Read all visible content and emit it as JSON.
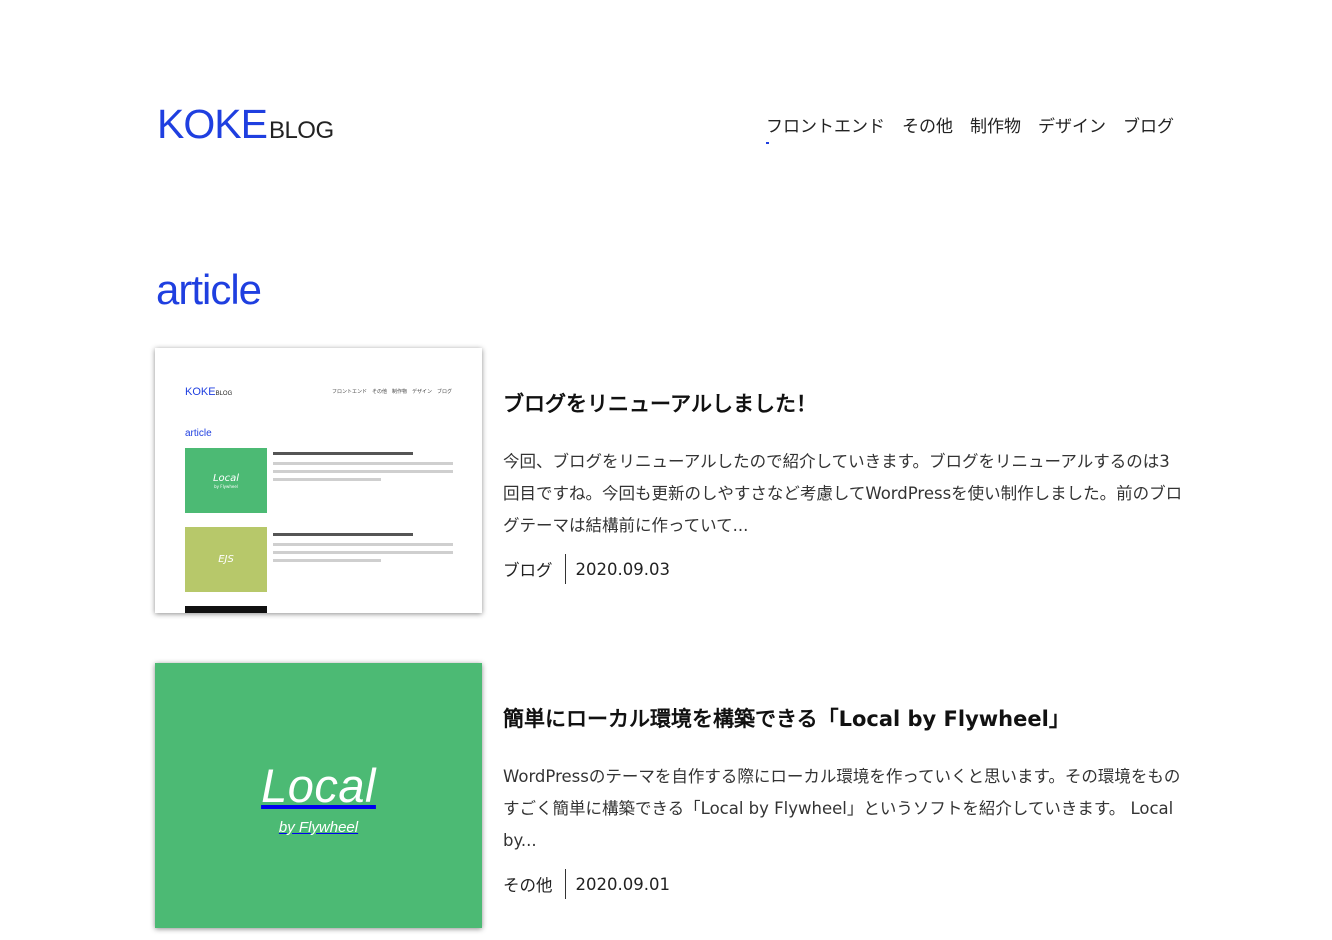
{
  "header": {
    "logo_main": "KOKE",
    "logo_sub": "BLOG",
    "nav": [
      "フロントエンド",
      "その他",
      "制作物",
      "デザイン",
      "ブログ"
    ]
  },
  "section_title": "article",
  "articles": [
    {
      "title": "ブログをリニューアルしました！",
      "excerpt": "今回、ブログをリニューアルしたので紹介していきます。ブログをリニューアルするのは3回目ですね。今回も更新のしやすさなど考慮してWordPressを使い制作しました。前のブログテーマは結構前に作っていて...",
      "category": "ブログ",
      "date": "2020.09.03",
      "thumbnail": {
        "type": "site-screenshot",
        "logo_main": "KOKE",
        "logo_sub": "BLOG",
        "nav": "フロントエンド　その他　制作物　デザイン　ブログ",
        "section_title": "article",
        "cards": [
          {
            "label": "Local",
            "sub": "by Flywheel",
            "color": "#4cba74"
          },
          {
            "label": "EJS",
            "sub": "",
            "color": "#b7c86a"
          }
        ]
      }
    },
    {
      "title": "簡単にローカル環境を構築できる「Local by Flywheel」",
      "excerpt": "WordPressのテーマを自作する際にローカル環境を作っていくと思います。その環境をものすごく簡単に構築できる「Local by Flywheel」というソフトを紹介していきます。 Local by...",
      "category": "その他",
      "date": "2020.09.01",
      "thumbnail": {
        "type": "brand-image",
        "word": "Local",
        "sub": "by Flywheel",
        "color": "#4cba74"
      }
    }
  ],
  "colors": {
    "accent": "#1f3fe0",
    "text": "#222222",
    "local_green": "#4cba74"
  }
}
